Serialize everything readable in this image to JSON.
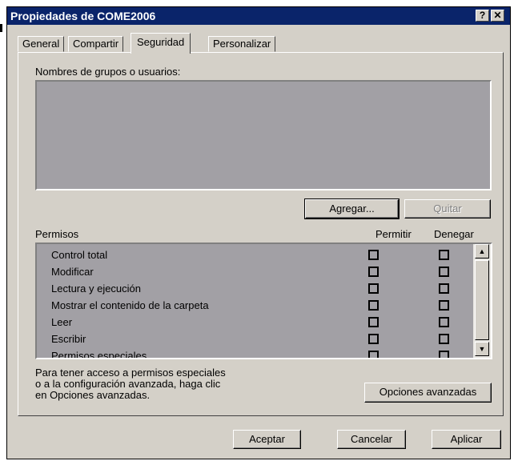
{
  "window": {
    "title": "Propiedades de COME2006",
    "help_glyph": "?",
    "close_glyph": "✕"
  },
  "tabs": [
    {
      "label": "General"
    },
    {
      "label": "Compartir"
    },
    {
      "label": "Seguridad",
      "active": true
    },
    {
      "label": "Personalizar"
    }
  ],
  "security": {
    "groups_label": "Nombres de grupos o usuarios:",
    "add_button": "Agregar...",
    "remove_button": "Quitar",
    "permissions_label": "Permisos",
    "allow_header": "Permitir",
    "deny_header": "Denegar",
    "permissions": [
      {
        "name": "Control total",
        "allow": false,
        "deny": false
      },
      {
        "name": "Modificar",
        "allow": false,
        "deny": false
      },
      {
        "name": "Lectura y ejecución",
        "allow": false,
        "deny": false
      },
      {
        "name": "Mostrar el contenido de la carpeta",
        "allow": false,
        "deny": false
      },
      {
        "name": "Leer",
        "allow": false,
        "deny": false
      },
      {
        "name": "Escribir",
        "allow": false,
        "deny": false
      },
      {
        "name": "Permisos especiales",
        "allow": false,
        "deny": false
      }
    ],
    "info_text": "Para tener acceso a permisos especiales\no a la configuración avanzada, haga clic\nen Opciones avanzadas.",
    "advanced_button": "Opciones avanzadas"
  },
  "footer": {
    "ok_button": "Aceptar",
    "cancel_button": "Cancelar",
    "apply_button": "Aplicar"
  },
  "colors": {
    "titlebar": "#0a246a",
    "face": "#d4d0c8",
    "list_background": "#a2a0a5"
  }
}
